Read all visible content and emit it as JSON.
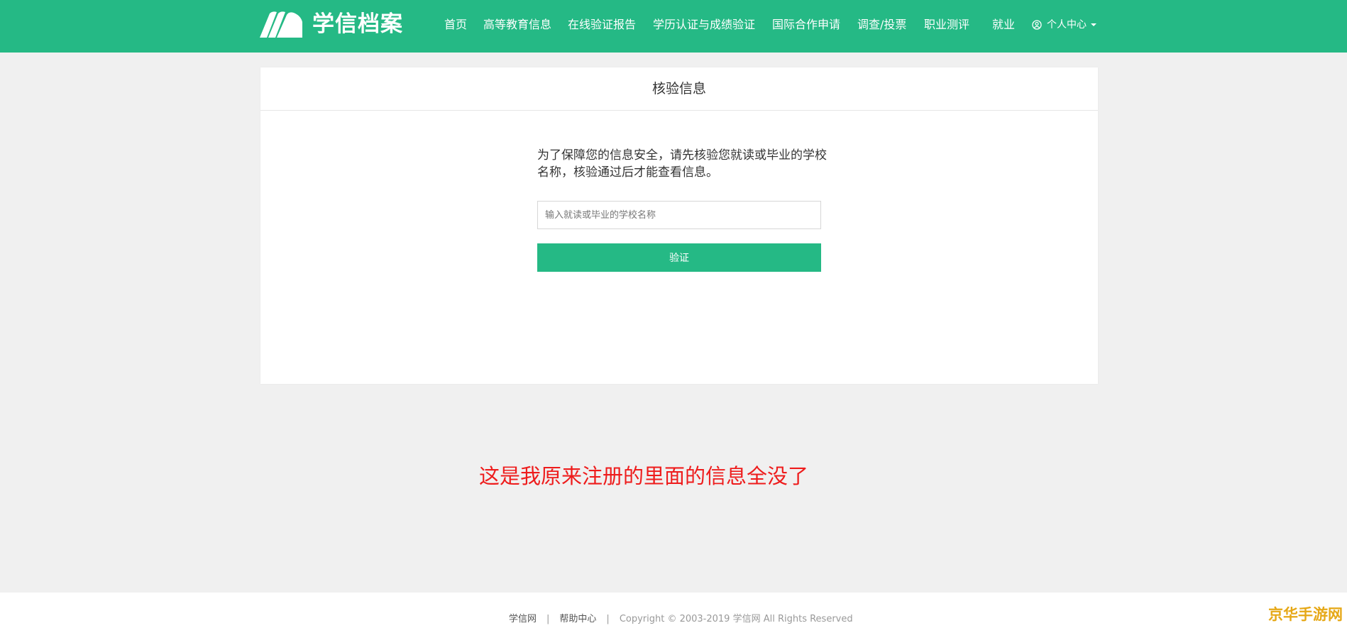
{
  "header": {
    "logo_text": "学信档案",
    "logo_icon": "book-pages-icon",
    "nav": [
      {
        "label": "首页"
      },
      {
        "label": "高等教育信息"
      },
      {
        "label": "在线验证报告"
      },
      {
        "label": "学历认证与成绩验证"
      },
      {
        "label": "国际合作申请"
      },
      {
        "label": "调查/投票"
      },
      {
        "label": "职业测评"
      },
      {
        "label": "就业"
      }
    ],
    "user_center": {
      "label": "个人中心",
      "icon": "user-circle-icon"
    },
    "bg_color": "#25b985"
  },
  "card": {
    "title": "核验信息",
    "description": "为了保障您的信息安全，请先核验您就读或毕业的学校名称，核验通过后才能查看信息。",
    "input": {
      "value": "",
      "placeholder": "输入就读或毕业的学校名称"
    },
    "button_label": "验证"
  },
  "annotation": {
    "text": "这是我原来注册的里面的信息全没了",
    "color": "#ee1c1c"
  },
  "footer": {
    "link1": "学信网",
    "link2": "帮助中心",
    "separator": "|",
    "copyright": "Copyright © 2003-2019 学信网 All Rights Reserved"
  },
  "watermark": {
    "text": "京华手游网"
  }
}
